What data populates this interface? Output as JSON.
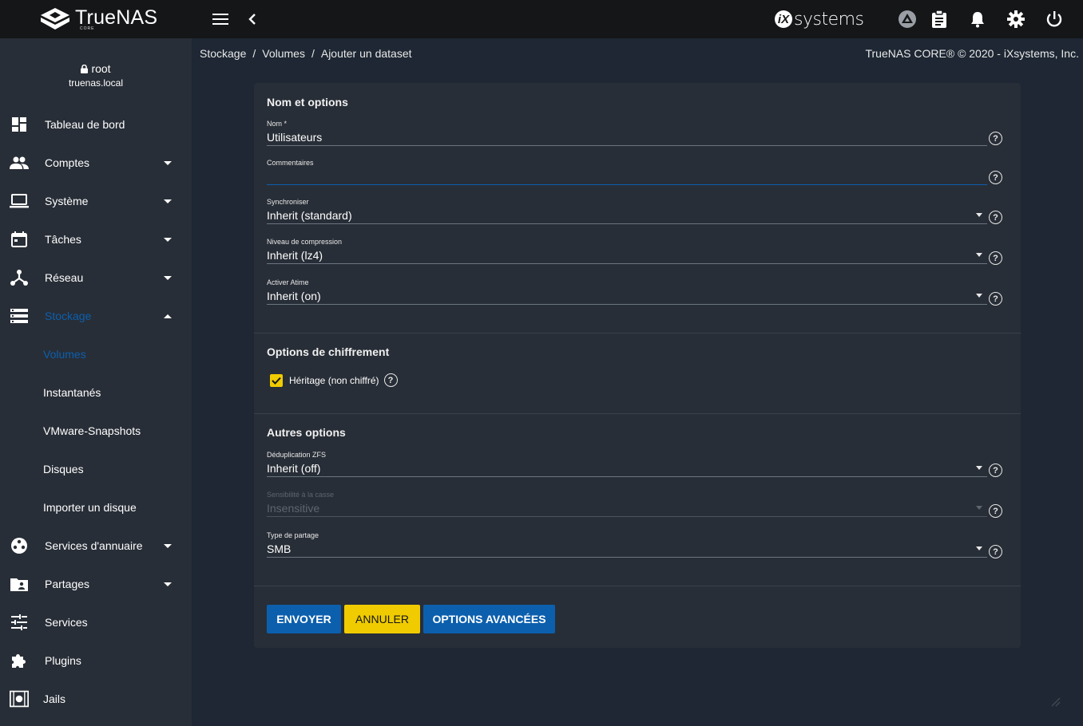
{
  "topbar": {
    "brand": "TrueNAS",
    "brand_sub": "CORE",
    "vendor": "systems",
    "vendor_mark": "iX"
  },
  "user": {
    "name": "root",
    "host": "truenas.local"
  },
  "sidebar": {
    "items": [
      {
        "label": "Tableau de bord",
        "icon": "dashboard-icon"
      },
      {
        "label": "Comptes",
        "icon": "people-icon"
      },
      {
        "label": "Système",
        "icon": "laptop-icon"
      },
      {
        "label": "Tâches",
        "icon": "calendar-icon"
      },
      {
        "label": "Réseau",
        "icon": "network-icon"
      },
      {
        "label": "Stockage",
        "icon": "storage-icon"
      },
      {
        "label": "Volumes"
      },
      {
        "label": "Instantanés"
      },
      {
        "label": "VMware-Snapshots"
      },
      {
        "label": "Disques"
      },
      {
        "label": "Importer un disque"
      },
      {
        "label": "Services d'annuaire",
        "icon": "directory-icon"
      },
      {
        "label": "Partages",
        "icon": "folder-share-icon"
      },
      {
        "label": "Services",
        "icon": "tune-icon"
      },
      {
        "label": "Plugins",
        "icon": "puzzle-icon"
      },
      {
        "label": "Jails",
        "icon": "jail-icon"
      }
    ]
  },
  "breadcrumb": {
    "items": [
      "Stockage",
      "Volumes",
      "Ajouter un dataset"
    ],
    "separator": "/"
  },
  "copyright": "TrueNAS CORE® © 2020 - iXsystems, Inc.",
  "form": {
    "section1_title": "Nom et options",
    "name": {
      "label": "Nom *",
      "value": "Utilisateurs"
    },
    "comments": {
      "label": "Commentaires",
      "value": ""
    },
    "sync": {
      "label": "Synchroniser",
      "value": "Inherit (standard)"
    },
    "compression": {
      "label": "Niveau de compression",
      "value": "Inherit (lz4)"
    },
    "atime": {
      "label": "Activer Atime",
      "value": "Inherit (on)"
    },
    "section2_title": "Options de chiffrement",
    "encryption_checkbox": {
      "label": "Héritage (non chiffré)",
      "checked": true
    },
    "section3_title": "Autres options",
    "dedup": {
      "label": "Déduplication ZFS",
      "value": "Inherit (off)"
    },
    "case": {
      "label": "Sensibilité à la casse",
      "value": "Insensitive"
    },
    "share_type": {
      "label": "Type de partage",
      "value": "SMB"
    },
    "buttons": {
      "submit": "ENVOYER",
      "cancel": "ANNULER",
      "advanced": "OPTIONS AVANCÉES"
    },
    "help_glyph": "?"
  },
  "colors": {
    "accent_blue": "#0c5fad",
    "accent_yellow": "#f0cb00",
    "topbar": "#141618",
    "sidebar": "#282e37",
    "background": "#1e2733"
  }
}
